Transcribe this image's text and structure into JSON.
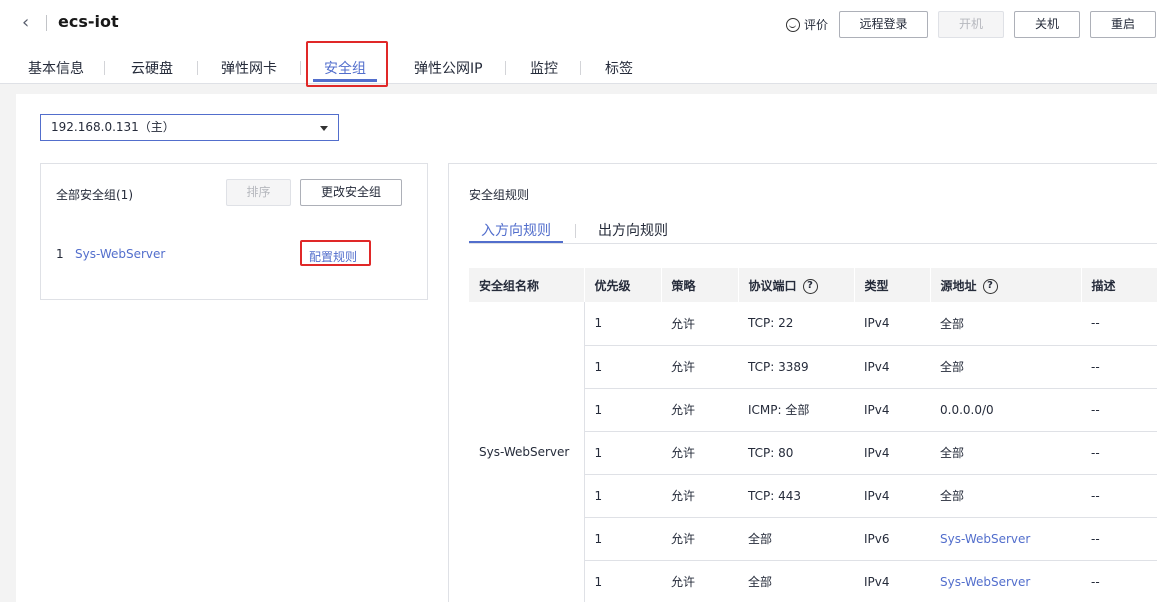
{
  "header": {
    "back_icon": "chevron-left-icon",
    "title": "ecs-iot",
    "rate_label": "评价",
    "rate_icon": "smile-icon",
    "buttons": {
      "remote_login": "远程登录",
      "power_on": "开机",
      "power_off": "关机",
      "restart": "重启"
    }
  },
  "tabs": [
    "基本信息",
    "云硬盘",
    "弹性网卡",
    "安全组",
    "弹性公网IP",
    "监控",
    "标签"
  ],
  "active_tab": "安全组",
  "nic_select": {
    "value": "192.168.0.131（主）"
  },
  "left_panel": {
    "title": "全部安全组(1)",
    "sort_label": "排序",
    "change_label": "更改安全组",
    "groups": [
      {
        "index": "1",
        "name": "Sys-WebServer",
        "action": "配置规则"
      }
    ]
  },
  "right_panel": {
    "title": "安全组规则",
    "subtabs": {
      "inbound": "入方向规则",
      "outbound": "出方向规则"
    },
    "columns": {
      "name": "安全组名称",
      "priority": "优先级",
      "policy": "策略",
      "protocol_port": "协议端口",
      "type": "类型",
      "source": "源地址",
      "desc": "描述"
    },
    "group_name": "Sys-WebServer",
    "rows": [
      {
        "priority": "1",
        "policy": "允许",
        "port": "TCP: 22",
        "type": "IPv4",
        "source": "全部",
        "source_link": false,
        "desc": "--"
      },
      {
        "priority": "1",
        "policy": "允许",
        "port": "TCP: 3389",
        "type": "IPv4",
        "source": "全部",
        "source_link": false,
        "desc": "--"
      },
      {
        "priority": "1",
        "policy": "允许",
        "port": "ICMP: 全部",
        "type": "IPv4",
        "source": "0.0.0.0/0",
        "source_link": false,
        "desc": "--"
      },
      {
        "priority": "1",
        "policy": "允许",
        "port": "TCP: 80",
        "type": "IPv4",
        "source": "全部",
        "source_link": false,
        "desc": "--"
      },
      {
        "priority": "1",
        "policy": "允许",
        "port": "TCP: 443",
        "type": "IPv4",
        "source": "全部",
        "source_link": false,
        "desc": "--"
      },
      {
        "priority": "1",
        "policy": "允许",
        "port": "全部",
        "type": "IPv6",
        "source": "Sys-WebServer",
        "source_link": true,
        "desc": "--"
      },
      {
        "priority": "1",
        "policy": "允许",
        "port": "全部",
        "type": "IPv4",
        "source": "Sys-WebServer",
        "source_link": true,
        "desc": "--"
      }
    ]
  },
  "colors": {
    "accent": "#526ecc",
    "highlight": "#e02828"
  }
}
